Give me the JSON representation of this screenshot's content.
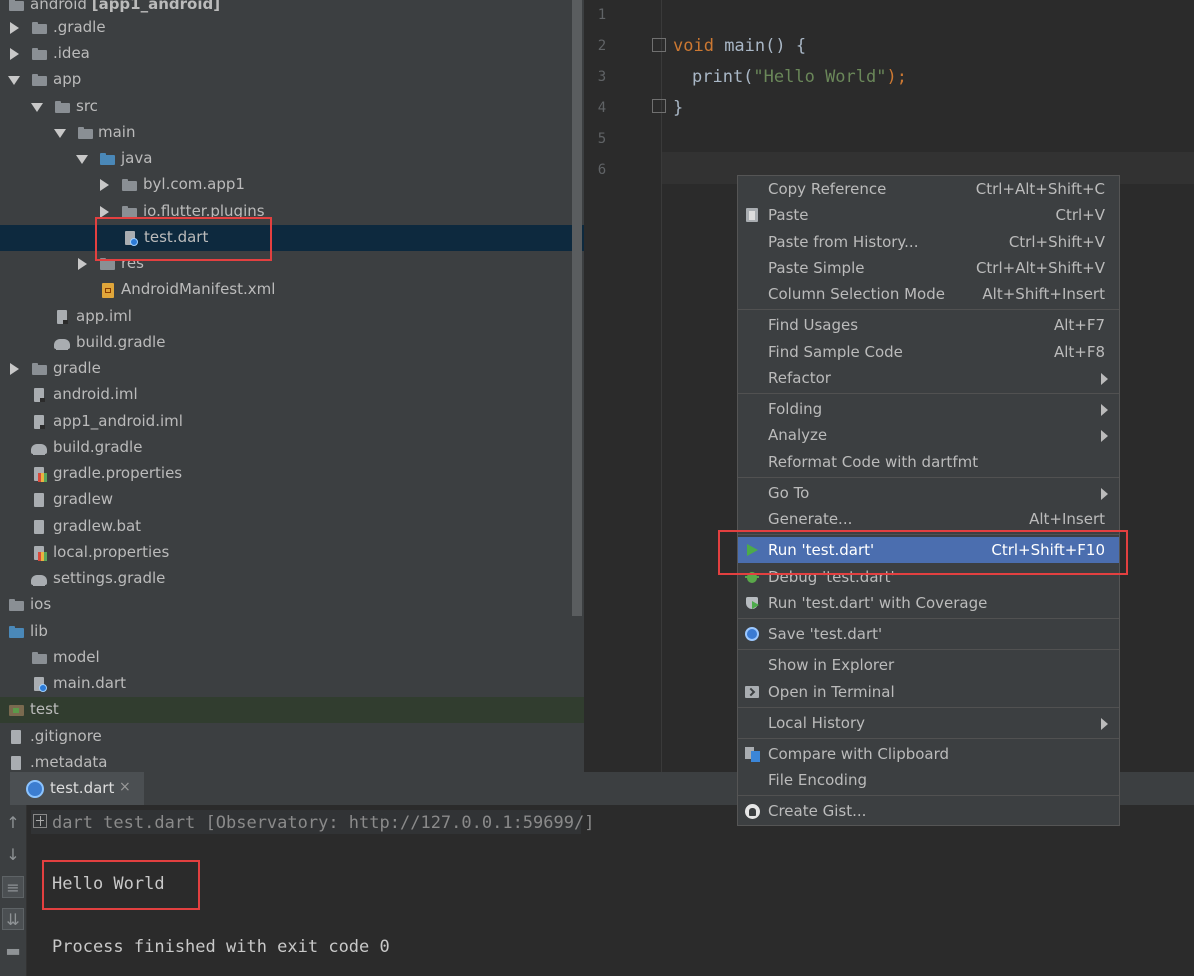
{
  "project_tree": {
    "items": [
      {
        "label": "android",
        "suffix": "[app1_android]",
        "icon": "folder-icon",
        "expand": "down"
      },
      {
        "label": ".gradle",
        "icon": "folder-icon",
        "expand": "right"
      },
      {
        "label": ".idea",
        "icon": "folder-icon",
        "expand": "right"
      },
      {
        "label": "app",
        "icon": "folder-icon",
        "expand": "down"
      },
      {
        "label": "src",
        "icon": "folder-icon",
        "expand": "down"
      },
      {
        "label": "main",
        "icon": "folder-icon",
        "expand": "down"
      },
      {
        "label": "java",
        "icon": "source-folder-icon",
        "expand": "down"
      },
      {
        "label": "byl.com.app1",
        "icon": "package-icon",
        "expand": "right"
      },
      {
        "label": "io.flutter.plugins",
        "icon": "package-icon",
        "expand": "right"
      },
      {
        "label": "test.dart",
        "icon": "dart-file-icon",
        "selected": true
      },
      {
        "label": "res",
        "icon": "folder-icon",
        "expand": "right"
      },
      {
        "label": "AndroidManifest.xml",
        "icon": "xml-file-icon"
      },
      {
        "label": "app.iml",
        "icon": "iml-file-icon"
      },
      {
        "label": "build.gradle",
        "icon": "gradle-icon"
      },
      {
        "label": "gradle",
        "icon": "folder-icon",
        "expand": "right"
      },
      {
        "label": "android.iml",
        "icon": "iml-file-icon"
      },
      {
        "label": "app1_android.iml",
        "icon": "iml-file-icon"
      },
      {
        "label": "build.gradle",
        "icon": "gradle-icon"
      },
      {
        "label": "gradle.properties",
        "icon": "properties-file-icon"
      },
      {
        "label": "gradlew",
        "icon": "file-icon"
      },
      {
        "label": "gradlew.bat",
        "icon": "file-icon"
      },
      {
        "label": "local.properties",
        "icon": "properties-file-icon"
      },
      {
        "label": "settings.gradle",
        "icon": "gradle-icon"
      },
      {
        "label": "ios",
        "icon": "folder-icon"
      },
      {
        "label": "lib",
        "icon": "source-folder-icon"
      },
      {
        "label": "model",
        "icon": "package-icon"
      },
      {
        "label": "main.dart",
        "icon": "dart-file-icon"
      },
      {
        "label": "test",
        "icon": "test-folder-icon"
      },
      {
        "label": ".gitignore",
        "icon": "file-icon"
      },
      {
        "label": ".metadata",
        "icon": "file-icon"
      }
    ]
  },
  "editor": {
    "line_numbers": [
      "1",
      "2",
      "3",
      "4",
      "5",
      "6"
    ],
    "code": {
      "l2_kw": "void",
      "l2_rest": " main() {",
      "l3_fn": "print(",
      "l3_str": "\"Hello World\"",
      "l3_rest": ");",
      "l4": "}"
    }
  },
  "context_menu": {
    "items": [
      {
        "label": "Copy Reference",
        "shortcut": "Ctrl+Alt+Shift+C"
      },
      {
        "label": "Paste",
        "shortcut": "Ctrl+V",
        "icon": "paste-icon"
      },
      {
        "label": "Paste from History...",
        "shortcut": "Ctrl+Shift+V"
      },
      {
        "label": "Paste Simple",
        "shortcut": "Ctrl+Alt+Shift+V"
      },
      {
        "label": "Column Selection Mode",
        "shortcut": "Alt+Shift+Insert"
      },
      {
        "label": "Find Usages",
        "shortcut": "Alt+F7"
      },
      {
        "label": "Find Sample Code",
        "shortcut": "Alt+F8"
      },
      {
        "label": "Refactor",
        "submenu": true
      },
      {
        "label": "Folding",
        "submenu": true
      },
      {
        "label": "Analyze",
        "submenu": true
      },
      {
        "label": "Reformat Code with dartfmt"
      },
      {
        "label": "Go To",
        "submenu": true
      },
      {
        "label": "Generate...",
        "shortcut": "Alt+Insert"
      },
      {
        "label": "Run 'test.dart'",
        "shortcut": "Ctrl+Shift+F10",
        "icon": "run-icon",
        "active": true
      },
      {
        "label": "Debug 'test.dart'",
        "icon": "debug-icon"
      },
      {
        "label": "Run 'test.dart' with Coverage",
        "icon": "coverage-icon"
      },
      {
        "label": "Save 'test.dart'",
        "icon": "dart-save-icon"
      },
      {
        "label": "Show in Explorer"
      },
      {
        "label": "Open in Terminal",
        "icon": "terminal-icon"
      },
      {
        "label": "Local History",
        "submenu": true
      },
      {
        "label": "Compare with Clipboard",
        "icon": "compare-icon"
      },
      {
        "label": "File Encoding"
      },
      {
        "label": "Create Gist...",
        "icon": "github-icon"
      }
    ]
  },
  "run_panel": {
    "tab_label": "test.dart",
    "tab_close": "×",
    "command": "dart test.dart [Observatory: http://127.0.0.1:59699/]",
    "output": "Hello World",
    "exit_message": "Process finished with exit code 0"
  },
  "colors": {
    "highlight_box": "#e34040",
    "menu_active": "#4b6eaf",
    "keyword": "#cc7832",
    "string": "#6a8759"
  }
}
